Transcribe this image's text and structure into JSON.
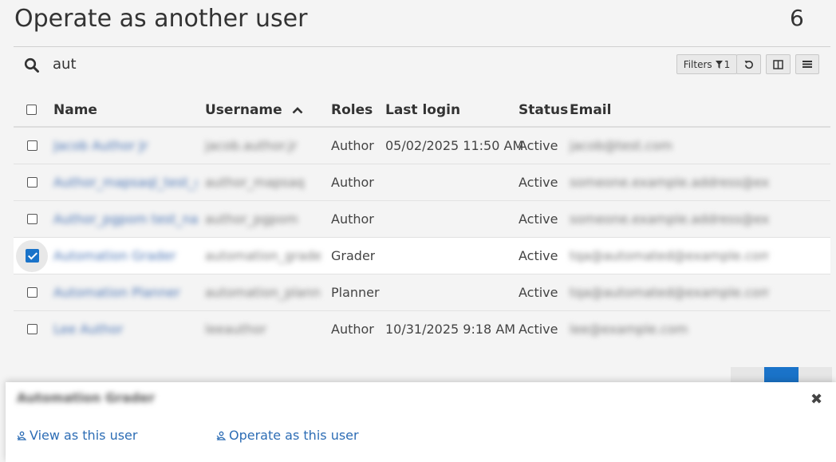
{
  "page": {
    "title": "Operate as another user",
    "count": "6"
  },
  "search": {
    "value": "aut",
    "icon": "search-icon"
  },
  "toolbar": {
    "filters_label": "Filters",
    "filters_count": "1",
    "reset_icon": "undo-icon",
    "columns_icon": "columns-icon",
    "menu_icon": "hamburger-menu-icon"
  },
  "table": {
    "headers": {
      "name": "Name",
      "username": "Username",
      "roles": "Roles",
      "last_login": "Last login",
      "status": "Status",
      "email": "Email"
    },
    "sort": {
      "column": "Username",
      "direction": "ascending"
    },
    "rows": [
      {
        "name": "Jacob Author Jr",
        "username": "jacob.author.jr",
        "role": "Author",
        "last_login": "05/02/2025 11:50 AM",
        "status": "Active",
        "email": "jacob@test.com",
        "selected": false
      },
      {
        "name": "Author_mapsaql_test_group",
        "username": "author_mapsaq",
        "role": "Author",
        "last_login": "",
        "status": "Active",
        "email": "someone.example.address@example.com",
        "selected": false
      },
      {
        "name": "Author_pgpom test_name",
        "username": "author_pgpom",
        "role": "Author",
        "last_login": "",
        "status": "Active",
        "email": "someone.example.address@example.com",
        "selected": false
      },
      {
        "name": "Automation Grader",
        "username": "automation_grader",
        "role": "Grader",
        "last_login": "",
        "status": "Active",
        "email": "tqa@automated@example.com",
        "selected": true
      },
      {
        "name": "Automation Planner",
        "username": "automation_planner",
        "role": "Planner",
        "last_login": "",
        "status": "Active",
        "email": "tqa@automated@example.com",
        "selected": false
      },
      {
        "name": "Lee Author",
        "username": "leeauthor",
        "role": "Author",
        "last_login": "10/31/2025 9:18 AM",
        "status": "Active",
        "email": "lee@example.com",
        "selected": false
      }
    ]
  },
  "popup": {
    "user_name": "Automation Grader",
    "view_label": "View as this user",
    "operate_label": "Operate as this user",
    "close_icon": "close-icon"
  },
  "colors": {
    "accent": "#1a73c9",
    "link": "#2d6db5",
    "background": "#f4f4f4"
  }
}
